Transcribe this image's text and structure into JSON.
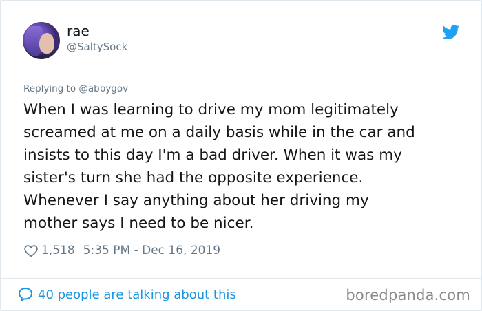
{
  "tweet": {
    "author_name": "rae",
    "author_handle": "@SaltySock",
    "replying_prefix": "Replying to",
    "replying_to": "@abbygov",
    "text": "When I was learning to drive my mom legitimately\nscreamed at me on a daily basis while in the car and\ninsists to this day I'm a bad driver. When it was my\nsister's turn she had the opposite experience.\nWhenever I say anything about her driving my\nmother says I need to be nicer.",
    "like_count": "1,518",
    "timestamp": "5:35 PM - Dec 16, 2019",
    "conversation_label": "40 people are talking about this"
  },
  "watermark": "boredpanda.com",
  "icons": {
    "platform": "twitter-bird-icon",
    "like": "heart-icon",
    "conversation": "speech-bubble-icon"
  },
  "colors": {
    "link_blue": "#1b95e0",
    "twitter_blue": "#1da1f2",
    "secondary_text": "#657786"
  }
}
